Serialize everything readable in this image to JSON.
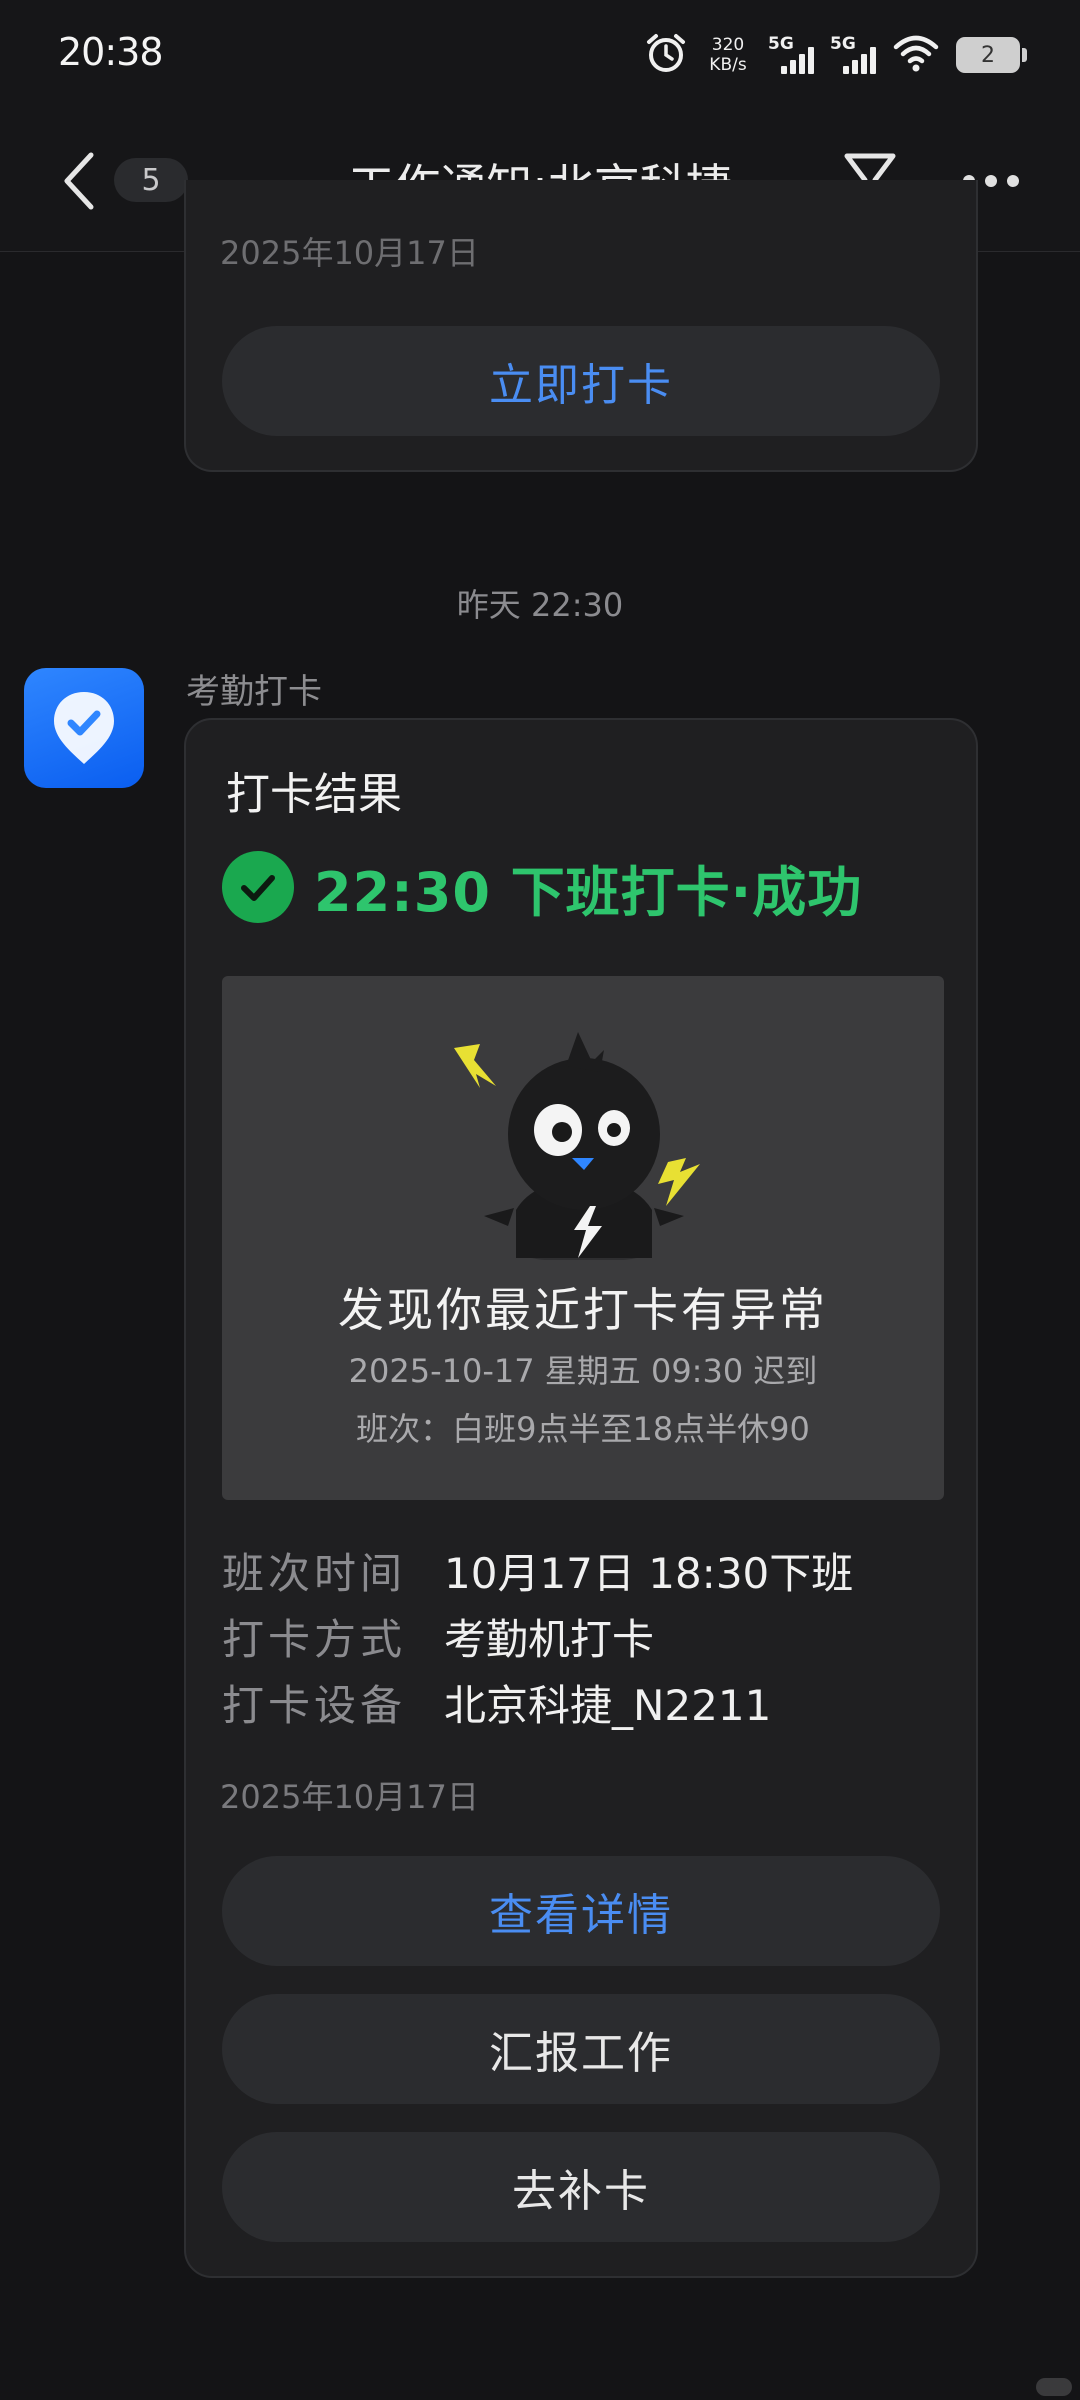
{
  "status_bar": {
    "time": "20:38",
    "net_speed_value": "320",
    "net_speed_unit": "KB/s",
    "signal1_label": "5G",
    "signal2_label": "5G",
    "battery_level": "2"
  },
  "header": {
    "title": "工作通知:北京科捷",
    "unread_count": "5"
  },
  "previous_message": {
    "date": "2025年10月17日",
    "action_label": "立即打卡"
  },
  "time_divider": "昨天 22:30",
  "message": {
    "sender": "考勤打卡",
    "card_title": "打卡结果",
    "result_text": "22:30 下班打卡·成功",
    "banner": {
      "title": "发现你最近打卡有异常",
      "line1": "2025-10-17 星期五 09:30 迟到",
      "line2": "班次：白班9点半至18点半休90"
    },
    "details": [
      {
        "label": "班次时间",
        "value": "10月17日 18:30下班"
      },
      {
        "label": "打卡方式",
        "value": "考勤机打卡"
      },
      {
        "label": "打卡设备",
        "value": "北京科捷_N2211"
      }
    ],
    "date": "2025年10月17日",
    "buttons": {
      "view_details": "查看详情",
      "report_work": "汇报工作",
      "make_up": "去补卡"
    }
  },
  "colors": {
    "accent_blue": "#4a8df2",
    "success_green": "#2ec56d",
    "background": "#141416",
    "card": "#1f1f21"
  }
}
